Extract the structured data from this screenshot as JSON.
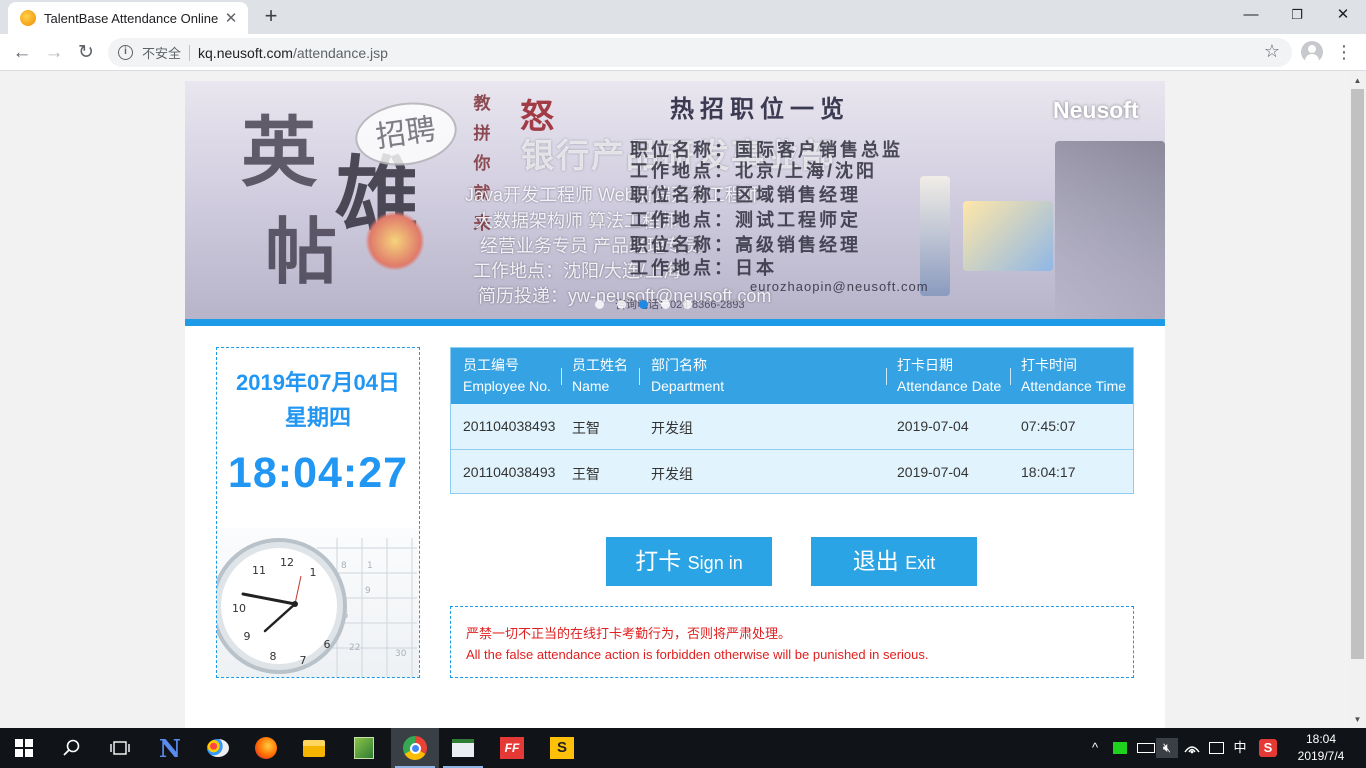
{
  "browser": {
    "tab_title": "TalentBase Attendance Online",
    "tab_close": "✕",
    "new_tab": "+",
    "insecure_label": "不安全",
    "url_host": "kq.neusoft.com",
    "url_path": "/attendance.jsp",
    "window_controls": {
      "minimize": "—",
      "maximize": "❐",
      "close": "✕"
    }
  },
  "banner": {
    "big_chars": [
      "英",
      "雄",
      "帖"
    ],
    "seal_text": "招聘",
    "side_chars": [
      "教",
      "拼",
      "你",
      "就",
      "来"
    ],
    "red_char": "怒",
    "heading": "热招职位一览",
    "logo": "Neusoft",
    "overlay_title": "银行产品研发事业部",
    "lines_white": [
      "Java开发工程师  Web前端开发工程师",
      "大数据架构师    算法工程师",
      "经营业务专员    产品经理专员",
      "工作地点：沈阳/大连/上海",
      "简历投递：yw-neusoft@neusoft.com"
    ],
    "lines_dark": [
      "职位名称：国际客户销售总监",
      "工作地点：北京/上海/沈阳",
      "职位名称：区域销售经理",
      "工作地点：测试工程师定",
      "职位名称：高级销售经理",
      "工作地点：日本"
    ],
    "email": "eurozhaopin@neusoft.com",
    "phone": "咨询电话：024-8366-2893",
    "slide_count": 5,
    "active_slide": 2
  },
  "clock_panel": {
    "date": "2019年07月04日",
    "weekday": "星期四",
    "time": "18:04:27"
  },
  "table": {
    "headers": [
      {
        "cn": "员工编号",
        "en": "Employee No."
      },
      {
        "cn": "员工姓名",
        "en": "Name"
      },
      {
        "cn": "部门名称",
        "en": "Department"
      },
      {
        "cn": "打卡日期",
        "en": "Attendance Date"
      },
      {
        "cn": "打卡时间",
        "en": "Attendance Time"
      }
    ],
    "rows": [
      [
        "201104038493",
        "王智",
        "开发组",
        "2019-07-04",
        "07:45:07"
      ],
      [
        "201104038493",
        "王智",
        "开发组",
        "2019-07-04",
        "18:04:17"
      ]
    ]
  },
  "buttons": {
    "sign_in_cn": "打卡",
    "sign_in_en": "Sign in",
    "exit_cn": "退出",
    "exit_en": "Exit"
  },
  "notice": {
    "cn": "严禁一切不正当的在线打卡考勤行为，否则将严肃处理。",
    "en": "All the false attendance action is forbidden otherwise will be punished in serious."
  },
  "taskbar": {
    "time": "18:04",
    "date": "2019/7/4",
    "ime": "中",
    "app_icons": [
      "windows-start-icon",
      "search-icon",
      "task-view-icon",
      "n-app-icon",
      "paint-app-icon",
      "firefox-icon",
      "file-explorer-icon",
      "notepad-app-icon",
      "chrome-icon",
      "terminal-app-icon",
      "ff-app-icon",
      "sublime-app-icon"
    ]
  },
  "colors": {
    "accent": "#1e9be6",
    "header_blue": "#35a3e3",
    "row_bg": "#e1f4fd",
    "notice_red": "#e02020",
    "time_blue": "#2196f3"
  }
}
